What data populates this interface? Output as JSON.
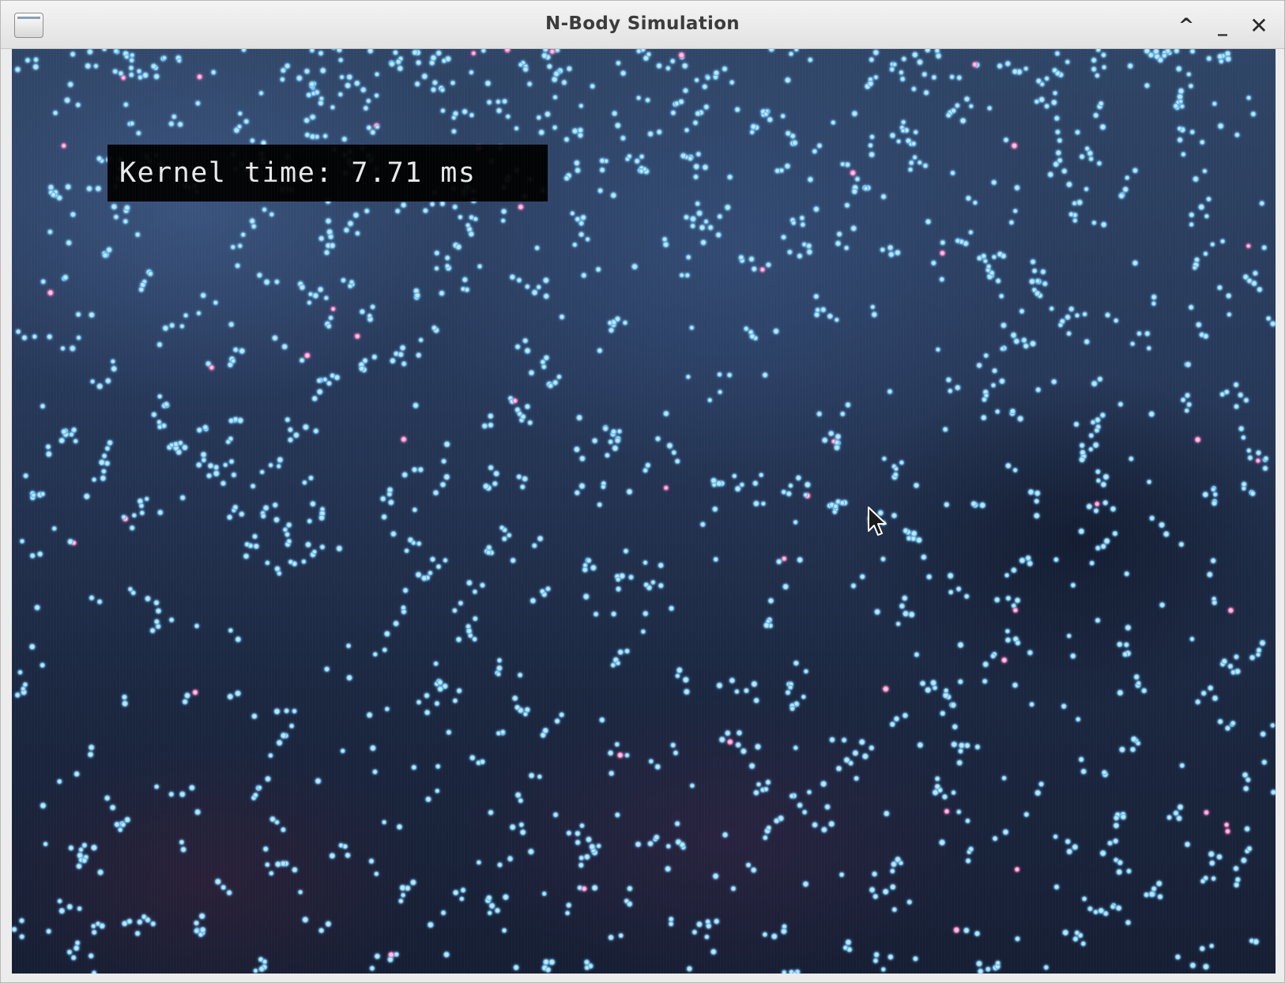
{
  "window": {
    "title": "N-Body Simulation",
    "icon": "window-menu-icon"
  },
  "controls": {
    "maximize_glyph": "^",
    "minimize_glyph": "_",
    "close_glyph": "✕"
  },
  "overlay": {
    "text": "Kernel time: 7.71 ms"
  },
  "colors": {
    "particle_blue": "#bfe6ff",
    "particle_blue_glow": "#5fb8f0",
    "particle_pink": "#ffc6e6",
    "particle_pink_glow": "#f06ab4",
    "background_top": "#2f4566",
    "background_bottom": "#161e33"
  }
}
